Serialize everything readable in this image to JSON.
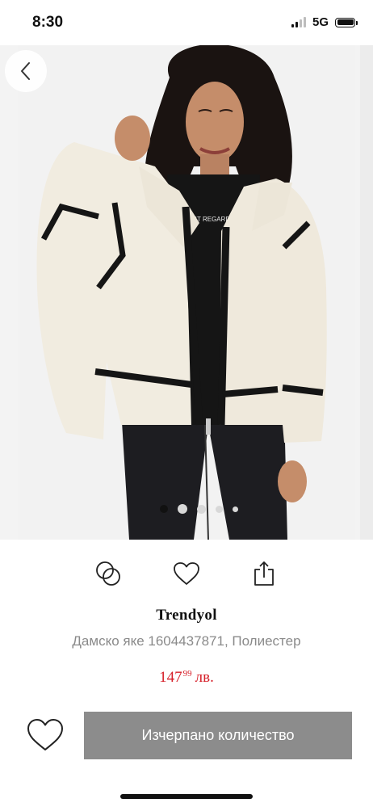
{
  "status_bar": {
    "time": "8:30",
    "network": "5G",
    "battery_level": 1.0,
    "signal_bars_active": 2,
    "signal_bars_total": 4
  },
  "gallery": {
    "image": {
      "icon": "product-photo-model-cream-teddy-jacket",
      "shirt_print": "BEST REGARDS"
    },
    "dots_count": 5,
    "active_index": 0
  },
  "actions": {
    "compare_icon": "compare-circles-icon",
    "favorite_icon": "heart-icon",
    "share_icon": "share-icon"
  },
  "product": {
    "brand": "Trendyol",
    "description": "Дамско яке  1604437871, Полиестер",
    "price_whole": "147",
    "price_cents": "99",
    "currency": "лв."
  },
  "bottom_bar": {
    "cta_label": "Изчерпано количество",
    "wishlist_icon": "heart-outline-icon"
  },
  "colors": {
    "price": "#d6202a",
    "cta_background": "#8c8c8c",
    "muted_text": "#8a8a8a"
  }
}
